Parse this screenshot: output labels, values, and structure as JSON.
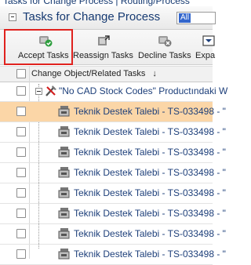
{
  "breadcrumb": "Tasks for Change Process | Routing/Process",
  "panel": {
    "title": "Tasks for Change Process",
    "filter_value": "All"
  },
  "toolbar": {
    "accept_label": "Accept Tasks",
    "reassign_label": "Reassign Tasks",
    "decline_label": "Decline Tasks",
    "expand_label": "Expa",
    "highlight_color": "#e0221e"
  },
  "grid": {
    "column_header": "Change Object/Related Tasks",
    "sort_indicator": "↓",
    "parent_row": "\"No CAD Stock Codes\" Productındaki W",
    "task_rows": [
      "Teknik Destek Talebi - TS-033498 - \"",
      "Teknik Destek Talebi - TS-033498 - \"",
      "Teknik Destek Talebi - TS-033498 - \"",
      "Teknik Destek Talebi - TS-033498 - \"",
      "Teknik Destek Talebi - TS-033498 - \"",
      "Teknik Destek Talebi - TS-033498 - \"",
      "Teknik Destek Talebi - TS-033498 - \"",
      "Teknik Destek Talebi - TS-033498 - \""
    ],
    "selected_row_color": "#fbd6a7"
  }
}
